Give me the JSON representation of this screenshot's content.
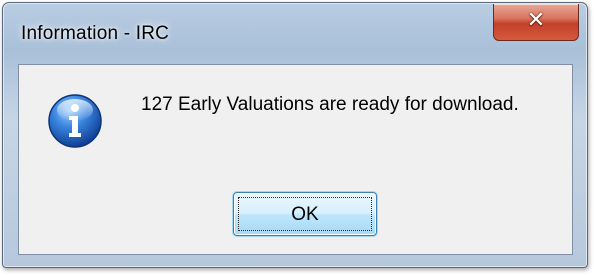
{
  "window": {
    "title": "Information - IRC"
  },
  "titlebar": {
    "close_icon": "✕",
    "close_icon_name": "close-icon"
  },
  "content": {
    "icon_name": "information-icon",
    "message": "127 Early Valuations are ready for download."
  },
  "buttons": {
    "ok_label": "OK"
  },
  "colors": {
    "close_button": "#c94a31",
    "ok_button_border": "#3c7fb1",
    "info_icon_blue": "#1f5fbf"
  }
}
